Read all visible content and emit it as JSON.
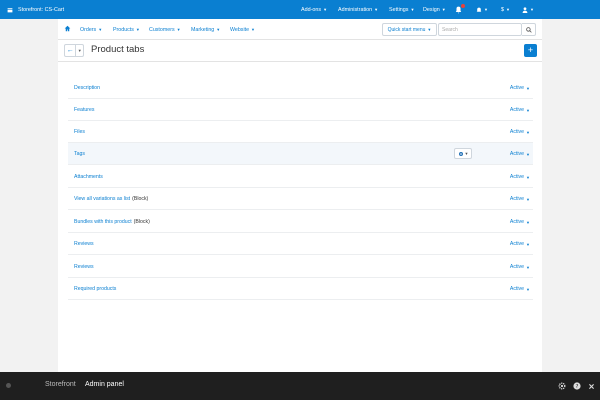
{
  "topbar": {
    "store_name": "Storefront: CS-Cart",
    "menus": [
      {
        "label": "Add-ons"
      },
      {
        "label": "Administration"
      },
      {
        "label": "Settings"
      },
      {
        "label": "Design"
      }
    ],
    "currency": "$"
  },
  "navbar": {
    "items": [
      {
        "label": "Orders"
      },
      {
        "label": "Products"
      },
      {
        "label": "Customers"
      },
      {
        "label": "Marketing"
      },
      {
        "label": "Website"
      }
    ],
    "quick_start_label": "Quick start menu",
    "search_placeholder": "Search"
  },
  "page": {
    "title": "Product tabs"
  },
  "tabs": [
    {
      "name": "Description",
      "suffix": "",
      "status": "Active"
    },
    {
      "name": "Features",
      "suffix": "",
      "status": "Active"
    },
    {
      "name": "Files",
      "suffix": "",
      "status": "Active"
    },
    {
      "name": "Tags",
      "suffix": "",
      "status": "Active"
    },
    {
      "name": "Attachments",
      "suffix": "",
      "status": "Active"
    },
    {
      "name": "View all variations as list",
      "suffix": "(Block)",
      "status": "Active"
    },
    {
      "name": "Bundles with this product",
      "suffix": "(Block)",
      "status": "Active"
    },
    {
      "name": "Reviews",
      "suffix": "",
      "status": "Active"
    },
    {
      "name": "Reviews",
      "suffix": "",
      "status": "Active"
    },
    {
      "name": "Required products",
      "suffix": "",
      "status": "Active"
    }
  ],
  "bottombar": {
    "storefront_label": "Storefront",
    "admin_label": "Admin panel"
  },
  "colors": {
    "accent": "#0a7fd1",
    "bottom_bar": "#1f1f1f",
    "notification": "#e6423c"
  }
}
